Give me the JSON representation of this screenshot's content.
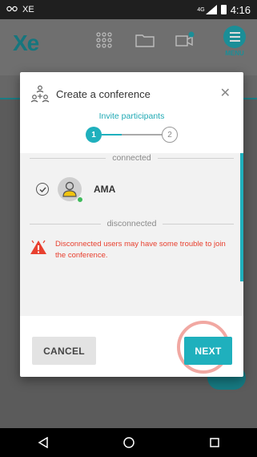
{
  "status_bar": {
    "carrier": "XE",
    "network": "4G",
    "time": "4:16"
  },
  "app_header": {
    "logo_text": "Xe",
    "menu_label": "MENU",
    "icons": [
      "grid-icon",
      "folder-icon",
      "video-settings-icon",
      "menu-icon"
    ]
  },
  "dialog": {
    "title": "Create a conference",
    "step_title": "Invite participants",
    "steps": [
      "1",
      "2"
    ],
    "current_step": 1,
    "sections": {
      "connected_label": "connected",
      "disconnected_label": "disconnected"
    },
    "connected_users": [
      {
        "name": "AMA",
        "selected": true,
        "status": "online"
      }
    ],
    "warning_text": "Disconnected users may have some trouble to join the conference.",
    "cancel_label": "CANCEL",
    "next_label": "NEXT"
  },
  "colors": {
    "accent": "#1fb0bd",
    "warning": "#e8402f",
    "online": "#3dbb5a"
  }
}
